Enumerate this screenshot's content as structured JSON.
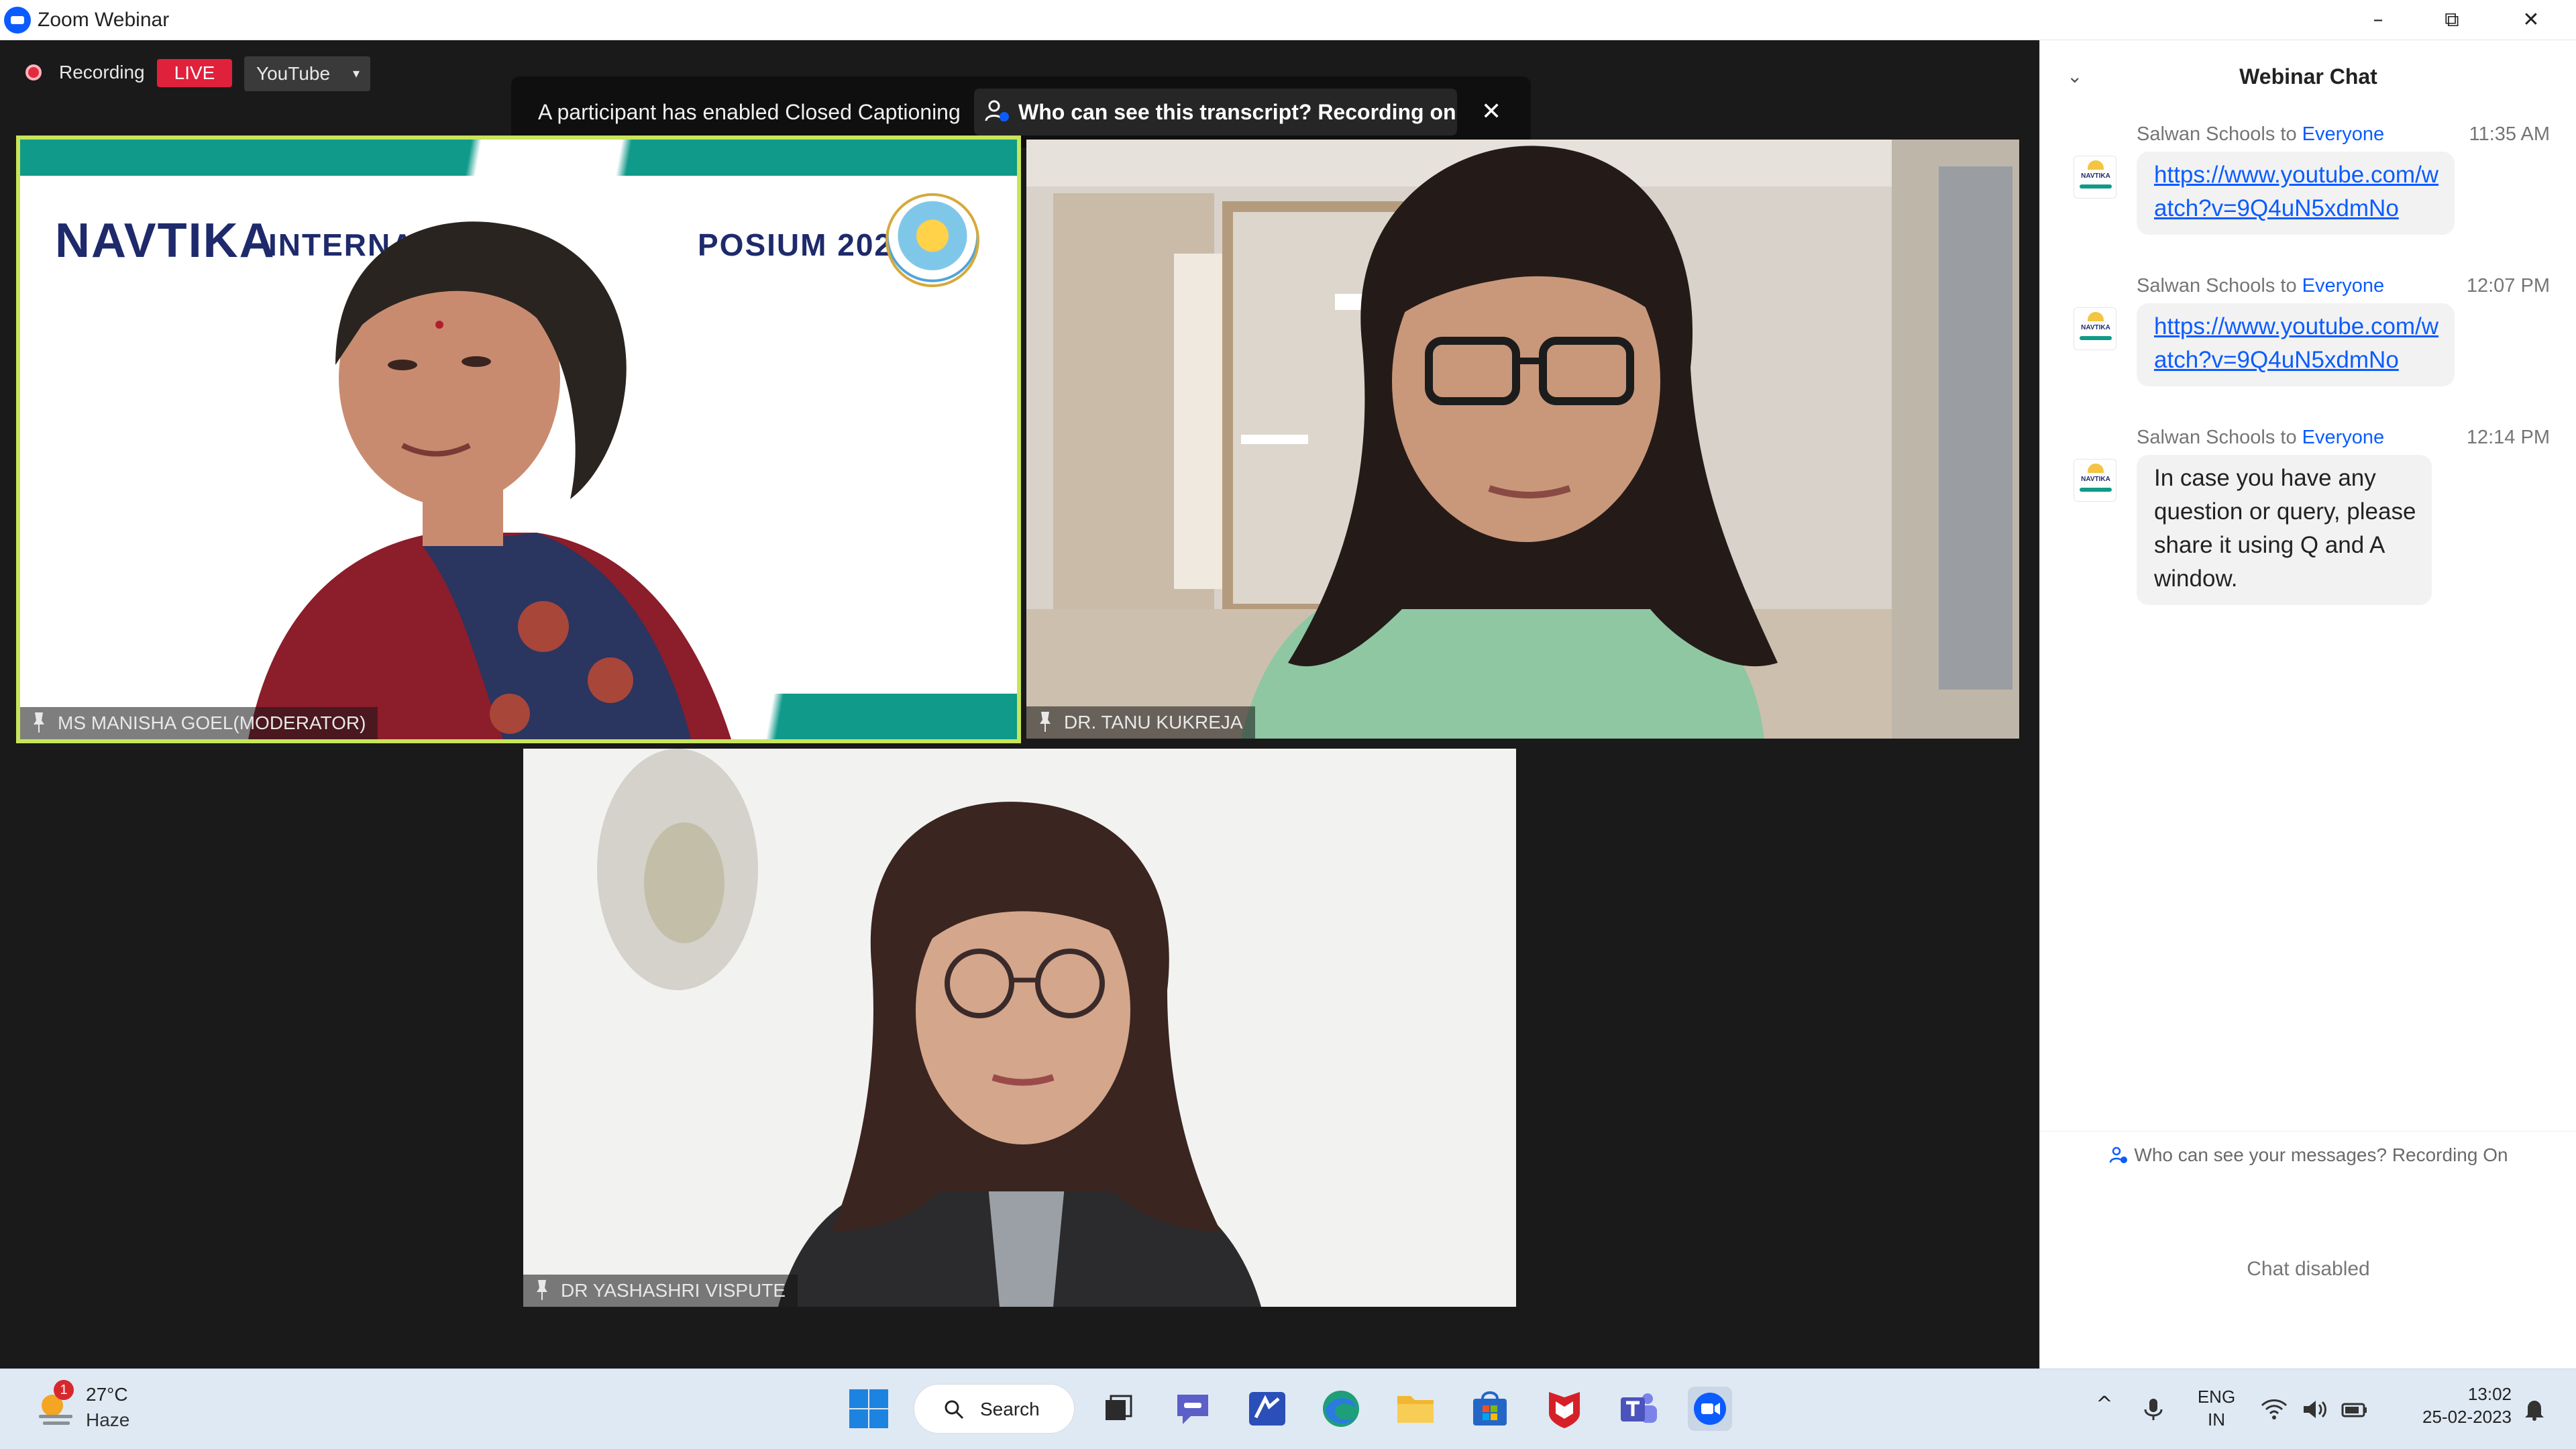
{
  "window": {
    "title": "Zoom Webinar",
    "controls": {
      "minimize": "–",
      "restore": "⧉",
      "close": "✕"
    }
  },
  "recording": {
    "label": "Recording",
    "live_badge": "LIVE",
    "stream_target": "YouTube",
    "caret": "▾"
  },
  "captions_notice": {
    "message": "A participant has enabled Closed Captioning",
    "transcript_question": "Who can see this transcript? Recording on",
    "close": "✕"
  },
  "tiles": [
    {
      "name": "MS MANISHA GOEL(MODERATOR)",
      "banner_logo": "NAVTIKA",
      "banner_title_left": "INTERNA",
      "banner_title_right": "POSIUM 2023"
    },
    {
      "name": "DR. TANU KUKREJA"
    },
    {
      "name": "DR YASHASHRI VISPUTE"
    }
  ],
  "chat": {
    "title": "Webinar Chat",
    "collapse_icon": "⌄",
    "avatar_text": "NAVTIKA",
    "messages": [
      {
        "sender": "Salwan Schools",
        "to_word": "to",
        "recipient": "Everyone",
        "time": "11:35 AM",
        "lines": [
          "https://www.youtube.com/w",
          "atch?v=9Q4uN5xdmNo"
        ],
        "is_link": true
      },
      {
        "sender": "Salwan Schools",
        "to_word": "to",
        "recipient": "Everyone",
        "time": "12:07 PM",
        "lines": [
          "https://www.youtube.com/w",
          "atch?v=9Q4uN5xdmNo"
        ],
        "is_link": true
      },
      {
        "sender": "Salwan Schools",
        "to_word": "to",
        "recipient": "Everyone",
        "time": "12:14 PM",
        "lines": [
          "In case you have any",
          "question or query, please",
          "share it using Q and A",
          "window."
        ],
        "is_link": false
      }
    ],
    "visibility_notice": "Who can see your messages? Recording On",
    "input_state": "Chat disabled"
  },
  "taskbar": {
    "weather": {
      "temperature": "27°C",
      "condition": "Haze",
      "badge": "1"
    },
    "search_label": "Search",
    "pinned_icons": [
      "file-explorer-icon",
      "teams-chat-icon",
      "whiteboard-icon",
      "edge-icon",
      "folder-icon",
      "store-icon",
      "mcafee-icon",
      "teams-icon",
      "zoom-icon"
    ],
    "tray": {
      "chevron": "^",
      "language_top": "ENG",
      "language_bottom": "IN",
      "time": "13:02",
      "date": "25-02-2023"
    }
  },
  "colors": {
    "zoom_blue": "#0b5cff",
    "live_red": "#e0213b",
    "active_speaker_border": "#c8e55a",
    "navtika_teal": "#0f9a8a",
    "navtika_navy": "#1e2a6b"
  }
}
